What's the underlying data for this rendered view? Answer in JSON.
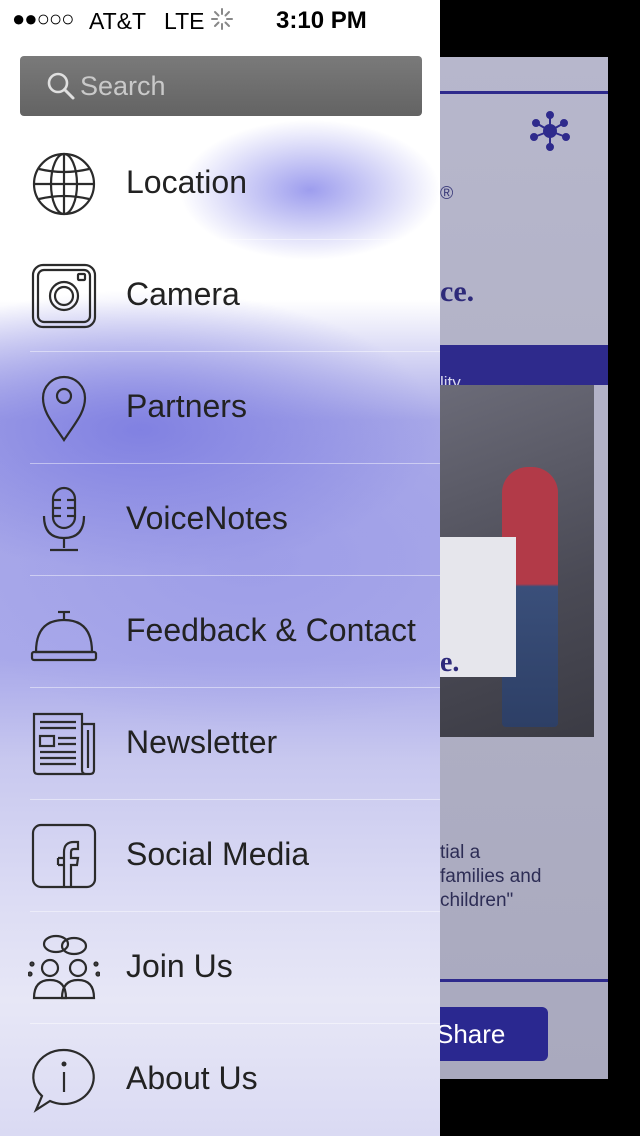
{
  "status_bar": {
    "signal": "●●○○○",
    "carrier": "AT&T",
    "network": "LTE",
    "time": "3:10 PM"
  },
  "search": {
    "placeholder": "Search"
  },
  "menu": {
    "items": [
      {
        "label": "Location",
        "icon": "globe-icon"
      },
      {
        "label": "Camera",
        "icon": "camera-icon"
      },
      {
        "label": "Partners",
        "icon": "map-pin-icon"
      },
      {
        "label": "VoiceNotes",
        "icon": "microphone-icon"
      },
      {
        "label": "Feedback & Contact",
        "icon": "service-bell-icon"
      },
      {
        "label": "Newsletter",
        "icon": "newspaper-icon"
      },
      {
        "label": "Social Media",
        "icon": "facebook-icon"
      },
      {
        "label": "Join Us",
        "icon": "group-chat-icon"
      },
      {
        "label": "About Us",
        "icon": "info-bubble-icon"
      }
    ]
  },
  "background": {
    "registered_mark": "®",
    "headline_fragment": "ce.",
    "band_fragment": "lity",
    "sign_fragment": "e.",
    "quote_lines": [
      "tial a",
      "families and",
      "children\""
    ],
    "share_label": "Share",
    "colors": {
      "brand": "#2e2a8c"
    }
  }
}
